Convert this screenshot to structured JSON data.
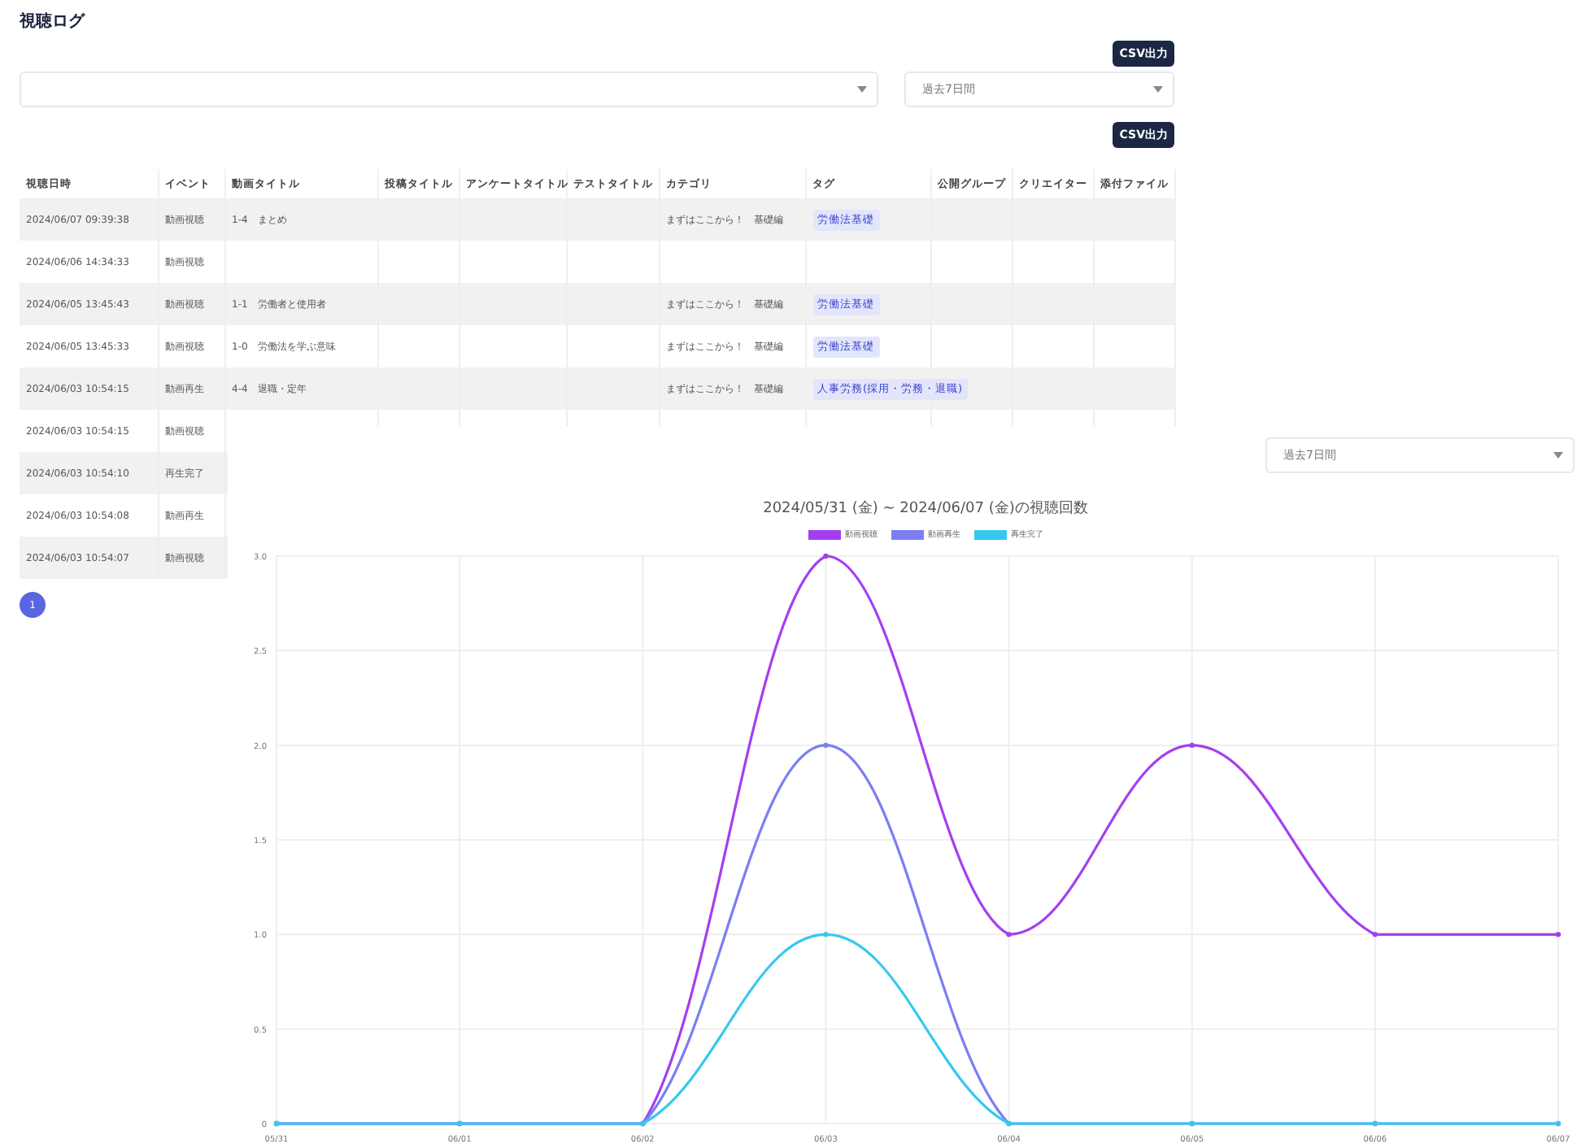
{
  "page_title": "視聴ログ",
  "top_csv_button": "CSV出力",
  "filters": {
    "period_select": {
      "value": "過去7日間"
    }
  },
  "table_csv_button": "CSV出力",
  "table": {
    "columns": [
      "視聴日時",
      "イベント",
      "動画タイトル",
      "投稿タイトル",
      "アンケートタイトル",
      "テストタイトル",
      "カテゴリ",
      "タグ",
      "公開グループ",
      "クリエイター",
      "添付ファイル"
    ],
    "rows": [
      {
        "cells": [
          "2024/06/07 09:39:38",
          "動画視聴",
          "1-4　まとめ",
          "",
          "",
          "",
          "まずはここから！　基礎編",
          "",
          "",
          "",
          ""
        ],
        "tags": [
          "労働法基礎"
        ]
      },
      {
        "cells": [
          "2024/06/06 14:34:33",
          "動画視聴",
          "",
          "",
          "",
          "",
          "",
          "",
          "",
          "",
          ""
        ],
        "tags": []
      },
      {
        "cells": [
          "2024/06/05 13:45:43",
          "動画視聴",
          "1-1　労働者と使用者",
          "",
          "",
          "",
          "まずはここから！　基礎編",
          "",
          "",
          "",
          ""
        ],
        "tags": [
          "労働法基礎"
        ]
      },
      {
        "cells": [
          "2024/06/05 13:45:33",
          "動画視聴",
          "1-0　労働法を学ぶ意味",
          "",
          "",
          "",
          "まずはここから！　基礎編",
          "",
          "",
          "",
          ""
        ],
        "tags": [
          "労働法基礎"
        ]
      },
      {
        "cells": [
          "2024/06/03 10:54:15",
          "動画再生",
          "4-4　退職・定年",
          "",
          "",
          "",
          "まずはここから！　基礎編",
          "",
          "",
          "",
          ""
        ],
        "tags": [
          "人事労務(採用・労務・退職)"
        ]
      },
      {
        "cells": [
          "2024/06/03 10:54:15",
          "動画視聴"
        ],
        "tags": []
      },
      {
        "cells": [
          "2024/06/03 10:54:10",
          "再生完了"
        ],
        "tags": []
      },
      {
        "cells": [
          "2024/06/03 10:54:08",
          "動画再生"
        ],
        "tags": []
      },
      {
        "cells": [
          "2024/06/03 10:54:07",
          "動画視聴"
        ],
        "tags": []
      }
    ]
  },
  "pagination": [
    {
      "label": "1",
      "selected": true
    }
  ],
  "chart_panel": {
    "period_select": {
      "value": "過去7日間"
    },
    "chart_data": {
      "type": "line",
      "title": "2024/05/31 (金) ~ 2024/06/07 (金)の視聴回数",
      "grid": true,
      "categories": [
        "05/31",
        "06/01",
        "06/02",
        "06/03",
        "06/04",
        "06/05",
        "06/06",
        "06/07"
      ],
      "series": [
        {
          "name": "動画視聴",
          "color": "#a43ff0",
          "marker": true,
          "values": [
            0,
            0,
            0,
            3,
            1,
            2,
            1,
            1
          ]
        },
        {
          "name": "動画再生",
          "color": "#7b7ff2",
          "marker": true,
          "values": [
            0,
            0,
            0,
            2,
            0,
            0,
            0,
            0
          ]
        },
        {
          "name": "再生完了",
          "color": "#36c8f0",
          "marker": true,
          "values": [
            0,
            0,
            0,
            1,
            0,
            0,
            0,
            0
          ]
        }
      ],
      "ylim": [
        0,
        3
      ],
      "yticks": [
        {
          "value": 0,
          "label": "0"
        },
        {
          "value": 0.5,
          "label": "0.5"
        },
        {
          "value": 1,
          "label": "1.0"
        },
        {
          "value": 1.5,
          "label": "1.5"
        },
        {
          "value": 2,
          "label": "2.0"
        },
        {
          "value": 2.5,
          "label": "2.5"
        },
        {
          "value": 3,
          "label": "3.0"
        }
      ]
    }
  }
}
